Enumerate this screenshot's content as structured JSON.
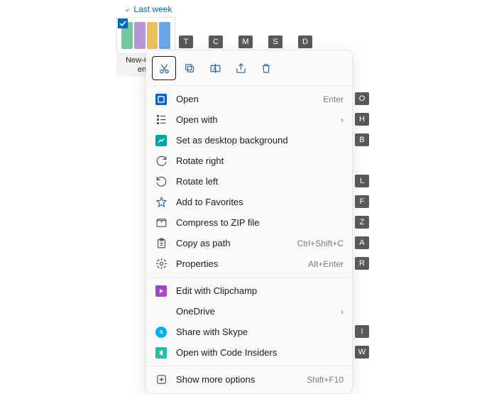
{
  "section": {
    "label": "Last week"
  },
  "thumbnail": {
    "line1": "New-Cha…",
    "line2": "en…"
  },
  "toolbar_key_hints": [
    "T",
    "C",
    "M",
    "S",
    "D"
  ],
  "menu": {
    "items": [
      {
        "label": "Open",
        "hint": "Enter",
        "key": "O"
      },
      {
        "label": "Open with",
        "submenu": true,
        "key": "H"
      },
      {
        "label": "Set as desktop background",
        "key": "B"
      },
      {
        "label": "Rotate right"
      },
      {
        "label": "Rotate left",
        "key": "L"
      },
      {
        "label": "Add to Favorites",
        "key": "F"
      },
      {
        "label": "Compress to ZIP file",
        "key": "Z"
      },
      {
        "label": "Copy as path",
        "hint": "Ctrl+Shift+C",
        "key": "A"
      },
      {
        "label": "Properties",
        "hint": "Alt+Enter",
        "key": "R"
      }
    ],
    "apps": [
      {
        "label": "Edit with Clipchamp"
      },
      {
        "label": "OneDrive",
        "submenu": true
      },
      {
        "label": "Share with Skype",
        "key": "I"
      },
      {
        "label": "Open with Code Insiders",
        "key": "W"
      }
    ],
    "more": {
      "label": "Show more options",
      "hint": "Shift+F10"
    }
  }
}
